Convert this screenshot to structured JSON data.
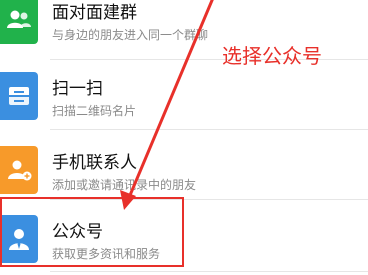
{
  "items": [
    {
      "title": "面对面建群",
      "desc": "与身边的朋友进入同一个群聊",
      "icon": "face-to-face-group-icon",
      "color": "#21b24b"
    },
    {
      "title": "扫一扫",
      "desc": "扫描二维码名片",
      "icon": "scan-icon",
      "color": "#3b8fe0"
    },
    {
      "title": "手机联系人",
      "desc": "添加或邀请通讯录中的朋友",
      "icon": "add-contact-icon",
      "color": "#f79a2a"
    },
    {
      "title": "公众号",
      "desc": "获取更多资讯和服务",
      "icon": "official-account-icon",
      "color": "#3b8fe0"
    }
  ],
  "annotation": {
    "text": "选择公众号",
    "color": "#e8302a"
  }
}
